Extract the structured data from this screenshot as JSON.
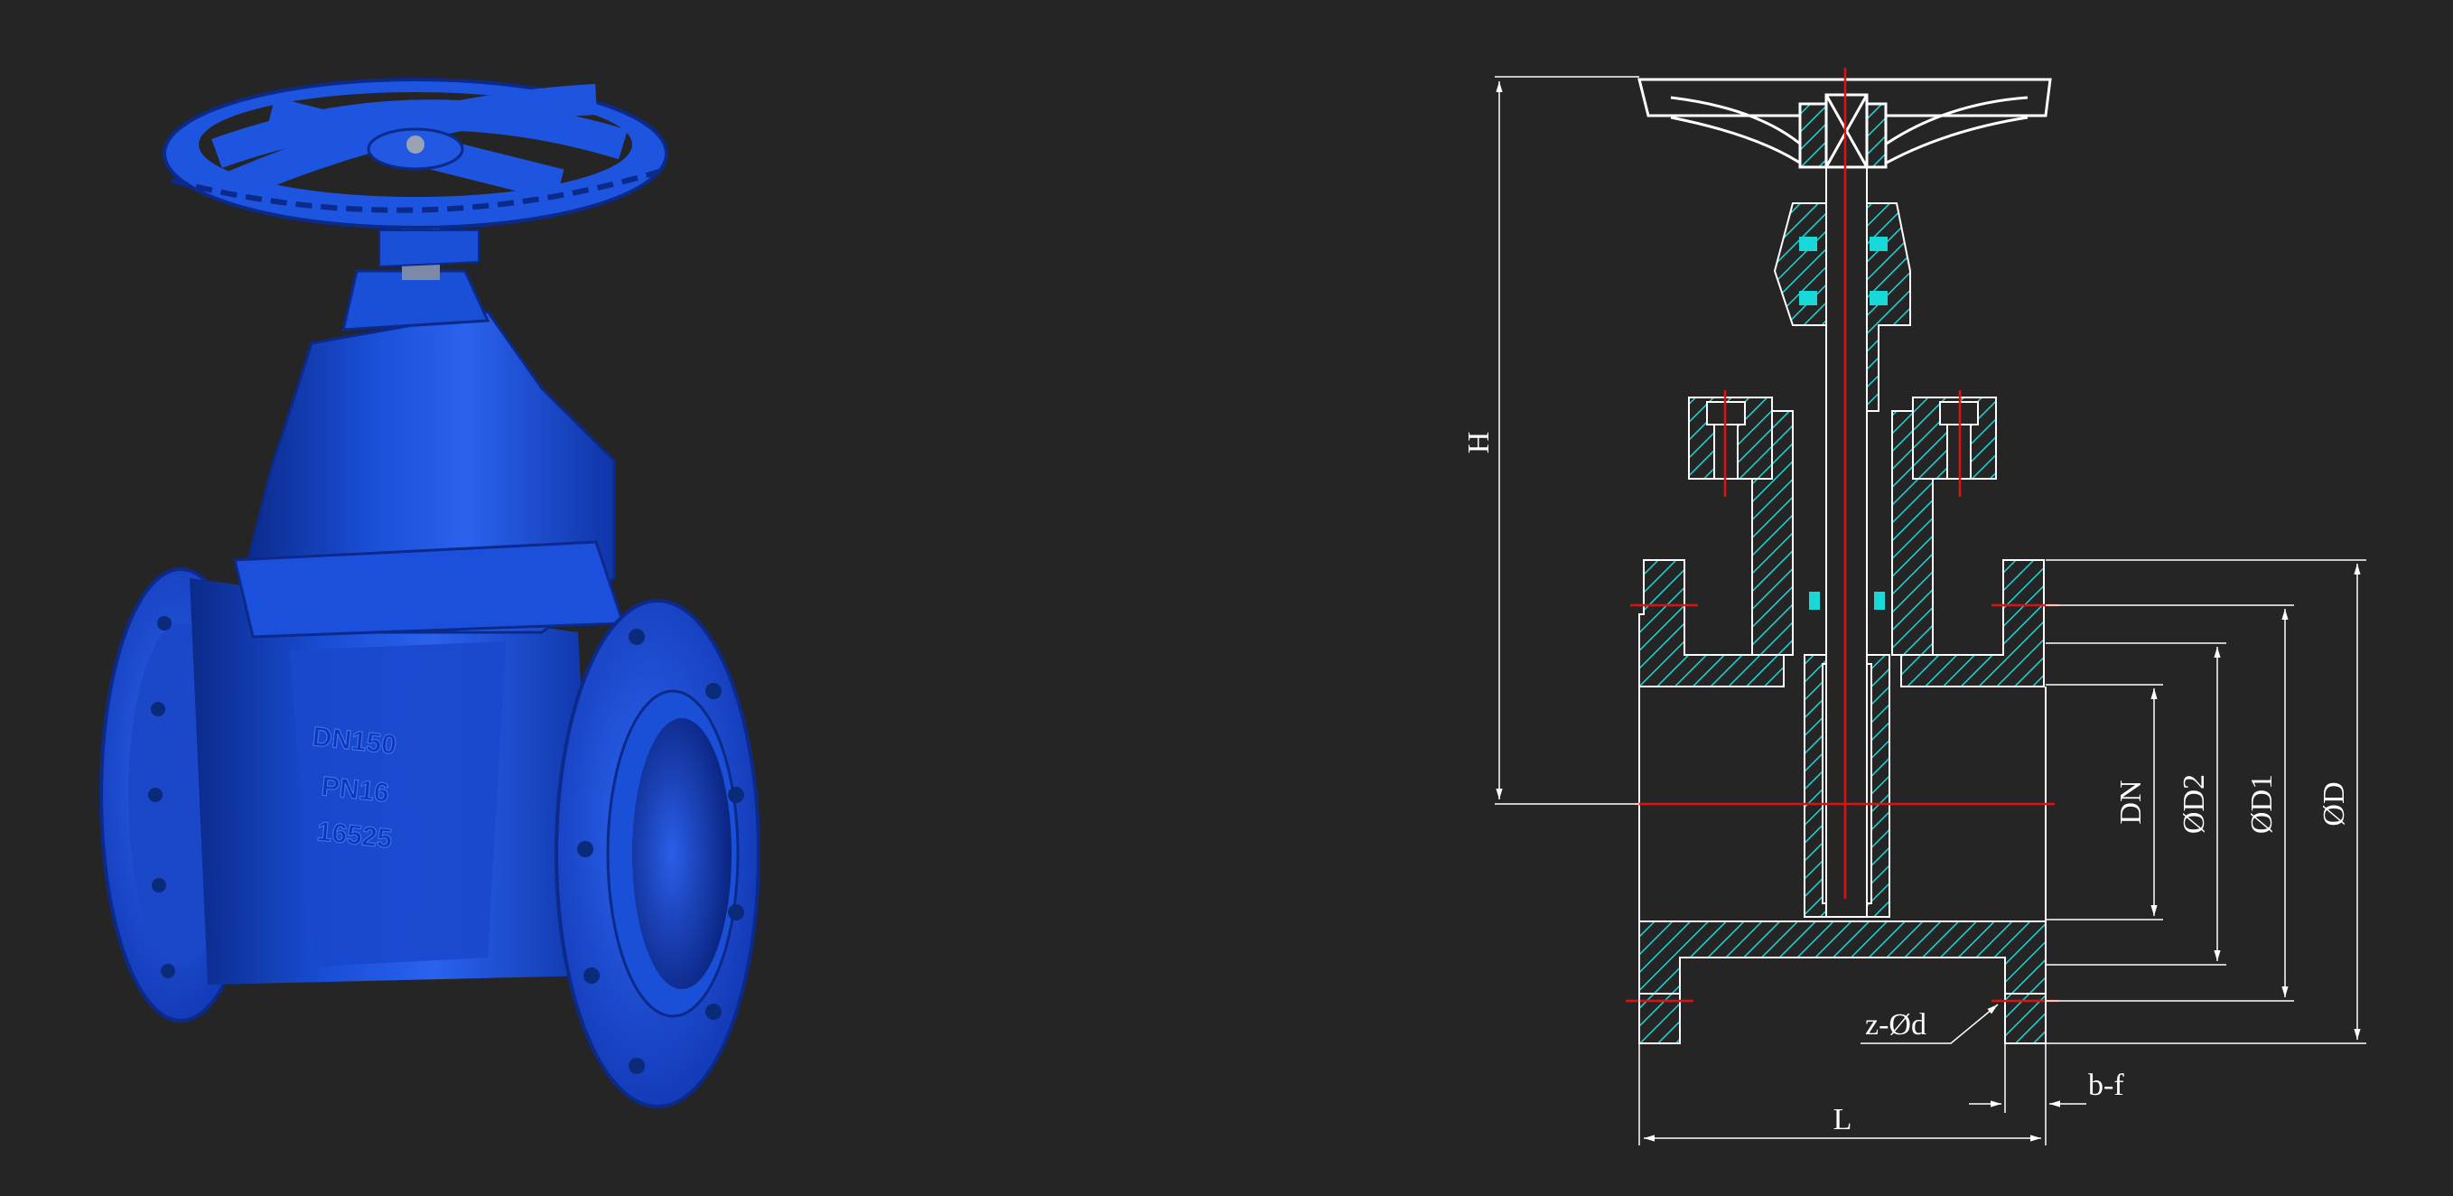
{
  "colors": {
    "background": "#252525",
    "valve_body": "#1a4fd8",
    "valve_highlight": "#4d7df5",
    "valve_shadow": "#0b2a8a",
    "hatch": "#18d8d8",
    "outline": "#ffffff",
    "centerline": "#e01010"
  },
  "photo": {
    "casting_marks": [
      "DN150",
      "PN16",
      "16525"
    ]
  },
  "drawing": {
    "labels": {
      "height": "H",
      "nominal_diameter": "DN",
      "d2": "ØD2",
      "d1": "ØD1",
      "d": "ØD",
      "bolt_holes": "z-Ød",
      "flange": "b-f",
      "length": "L"
    }
  }
}
